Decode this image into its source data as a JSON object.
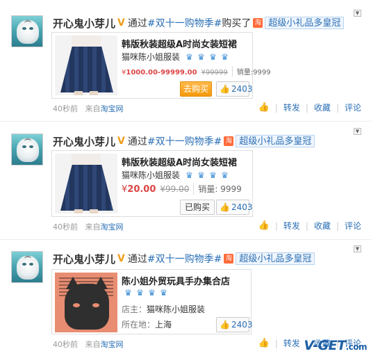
{
  "posts": [
    {
      "author": "开心鬼小芽儿",
      "verified": "V",
      "via": "通过",
      "topic": "#双十一购物季#",
      "action": "购买了",
      "tag": "超级小礼品多皇冠",
      "product": {
        "title": "韩版秋装超级A时尚女装短裙",
        "shop": "猫咪陈小姐服装",
        "currency": "¥",
        "price": "1000.00-99999.00",
        "old_price": "¥99999",
        "sales_label": "销量:",
        "sales": "9999",
        "buy_label": "去购买",
        "likes": "2403",
        "crowns": 4
      },
      "time": "40秒前",
      "source_prefix": "来自",
      "source": "淘宝网"
    },
    {
      "author": "开心鬼小芽儿",
      "verified": "V",
      "via": "通过",
      "topic": "#双十一购物季#",
      "tag": "超级小礼品多皇冠",
      "product": {
        "title": "韩版秋装超级A时尚女装短裙",
        "shop": "猫咪陈小姐服装",
        "currency": "¥",
        "price": "20.00",
        "old_price": "¥99.00",
        "sales_label": "销量:",
        "sales": "9999",
        "bought_label": "已购买",
        "likes": "2403",
        "crowns": 4
      },
      "time": "40秒前",
      "source_prefix": "来自",
      "source": "淘宝网"
    },
    {
      "author": "开心鬼小芽儿",
      "verified": "V",
      "via": "通过",
      "topic": "#双十一购物季#",
      "tag": "超级小礼品多皇冠",
      "shop_card": {
        "name": "陈小姐外贸玩具手办集合店",
        "owner_label": "店主：",
        "owner": "猫咪陈小姐服装",
        "location_label": "所在地：",
        "location": "上海",
        "likes": "2403",
        "crowns": 4
      },
      "time": "40秒前",
      "source_prefix": "来自",
      "source": "淘宝网"
    }
  ],
  "actions": {
    "forward": "转发",
    "favorite": "收藏",
    "comment": "评论"
  },
  "icons": {
    "tao": "淘",
    "crown": "♛",
    "thumb": "👍",
    "dropdown": "▼"
  },
  "watermark": "V-GET",
  "watermark_suffix": ".com",
  "colors": {
    "link": "#2b6fb5",
    "price": "#dd4444",
    "buy_button": "#f39a0a",
    "tao_icon": "#ff6a39",
    "verified": "#f19d1a"
  }
}
